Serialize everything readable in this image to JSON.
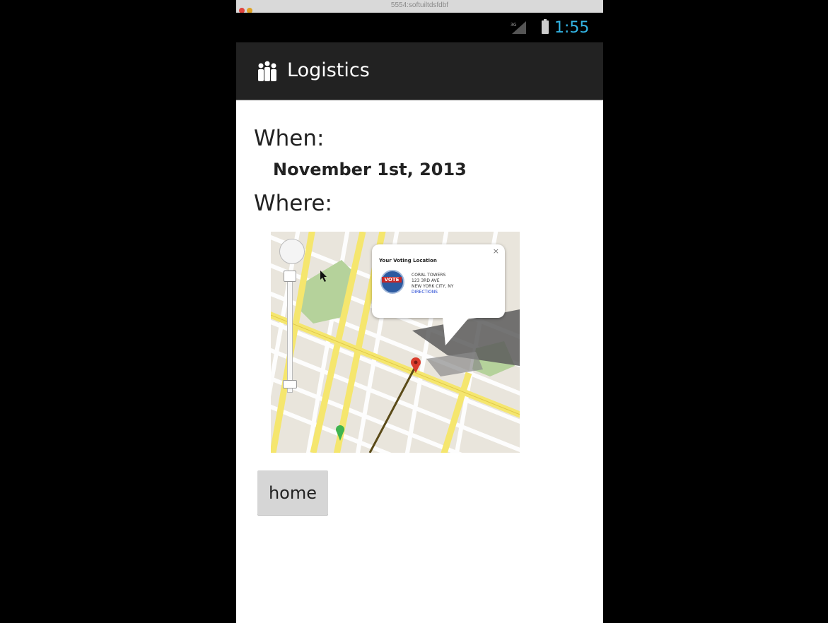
{
  "emulator": {
    "title": "5554:softuiltdsfdbf"
  },
  "status_bar": {
    "time": "1:55",
    "signal_icon": "signal-icon",
    "battery_icon": "battery-icon"
  },
  "action_bar": {
    "title": "Logistics",
    "icon": "app-logo-icon"
  },
  "content": {
    "when_label": "When:",
    "date": "November 1st, 2013",
    "where_label": "Where:",
    "map": {
      "info_window": {
        "title": "Your Voting Location",
        "logo_text": "VOTE",
        "name": "CORAL TOWERS",
        "address": "123 3RD AVE",
        "city": "NEW YORK CITY, NY",
        "link": "DIRECTIONS",
        "close": "×"
      }
    },
    "home_button_label": "home"
  },
  "colors": {
    "accent": "#33b5e5",
    "action_bar": "#222222",
    "road_major": "#f5e66e",
    "park": "#b5d29b",
    "marker_red": "#d93a2b",
    "marker_green": "#3fb44f"
  }
}
